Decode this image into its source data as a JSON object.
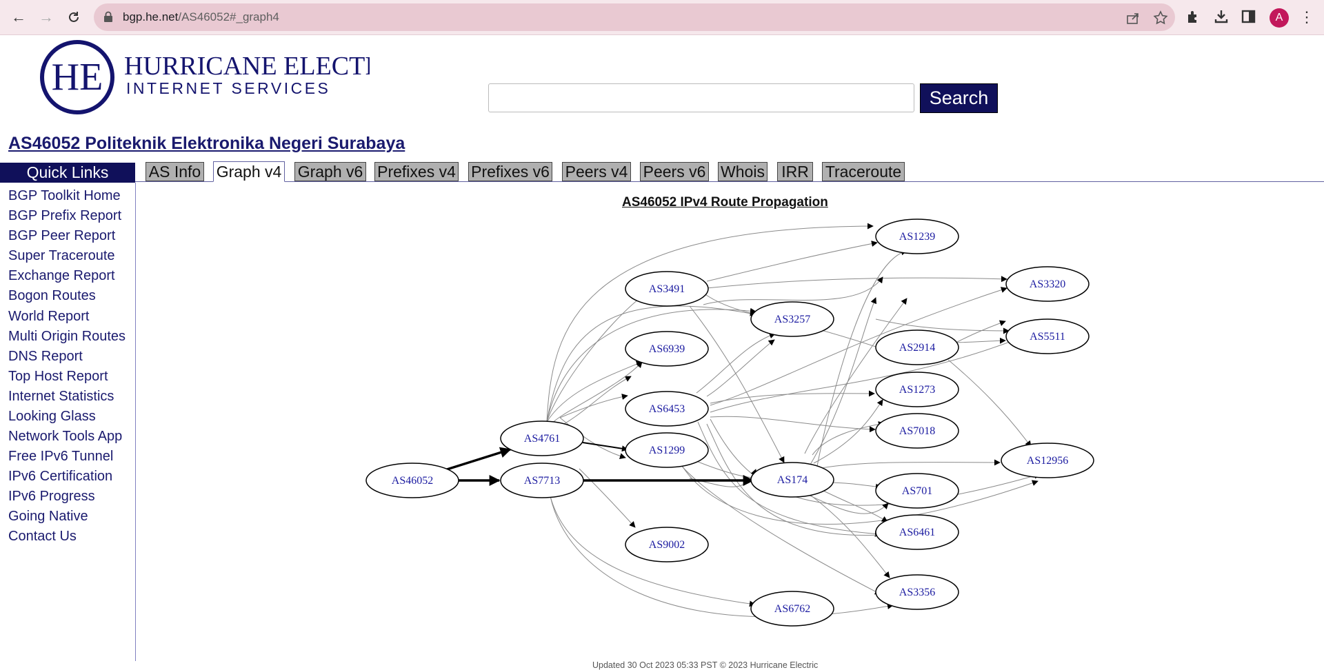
{
  "browser": {
    "url_host": "bgp.he.net",
    "url_path": "/AS46052#_graph4",
    "avatar_letter": "A"
  },
  "header": {
    "logo_line1": "HURRICANE ELECTRIC",
    "logo_line2": "INTERNET SERVICES",
    "logo_monogram": "HE",
    "search_placeholder": "",
    "search_button": "Search"
  },
  "page_title": "AS46052 Politeknik Elektronika Negeri Surabaya",
  "sidebar": {
    "header": "Quick Links",
    "items": [
      "BGP Toolkit Home",
      "BGP Prefix Report",
      "BGP Peer Report",
      "Super Traceroute",
      "Exchange Report",
      "Bogon Routes",
      "World Report",
      "Multi Origin Routes",
      "DNS Report",
      "Top Host Report",
      "Internet Statistics",
      "Looking Glass",
      "Network Tools App",
      "Free IPv6 Tunnel",
      "IPv6 Certification",
      "IPv6 Progress",
      "Going Native",
      "Contact Us"
    ]
  },
  "tabs": [
    "AS Info",
    "Graph v4",
    "Graph v6",
    "Prefixes v4",
    "Prefixes v6",
    "Peers v4",
    "Peers v6",
    "Whois",
    "IRR",
    "Traceroute"
  ],
  "active_tab": "Graph v4",
  "graph": {
    "title": "AS46052 IPv4 Route Propagation",
    "nodes": [
      "AS46052",
      "AS4761",
      "AS7713",
      "AS3491",
      "AS6939",
      "AS6453",
      "AS1299",
      "AS9002",
      "AS3257",
      "AS174",
      "AS6762",
      "AS1239",
      "AS2914",
      "AS1273",
      "AS7018",
      "AS701",
      "AS6461",
      "AS3356",
      "AS3320",
      "AS5511",
      "AS12956"
    ]
  },
  "footer": "Updated 30 Oct 2023 05:33 PST © 2023 Hurricane Electric"
}
